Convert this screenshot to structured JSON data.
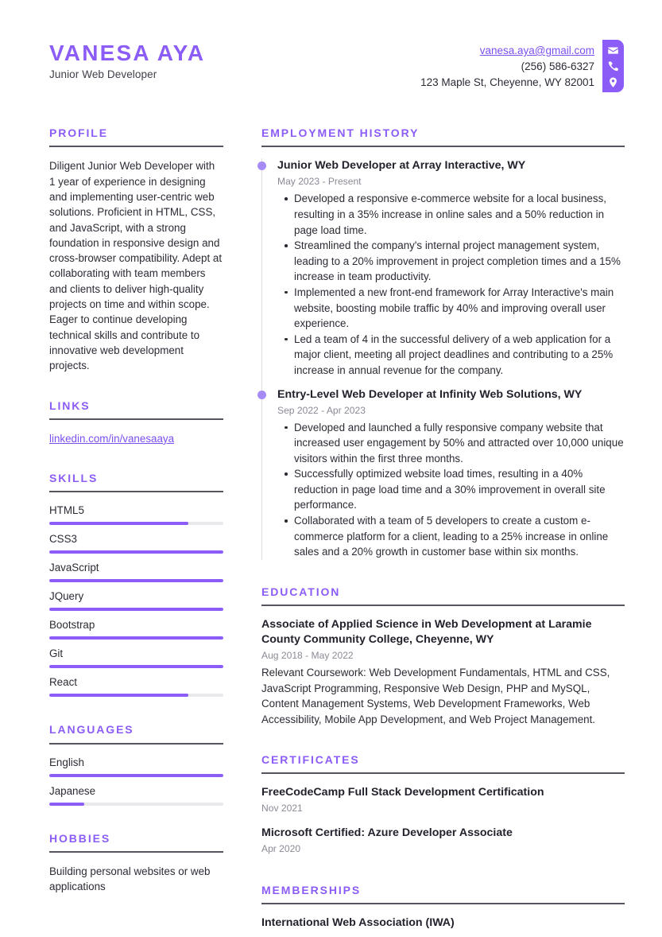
{
  "accent_color": "#8b5cf6",
  "link_color": "#7c4ff0",
  "rule_color": "#55555f",
  "header": {
    "name": "VANESA AYA",
    "title": "Junior Web Developer",
    "contacts": [
      {
        "icon": "envelope-icon",
        "value": "vanesa.aya@gmail.com",
        "is_link": true
      },
      {
        "icon": "phone-icon",
        "value": "(256) 586-6327",
        "is_link": false
      },
      {
        "icon": "location-pin-icon",
        "value": "123 Maple St, Cheyenne, WY 82001",
        "is_link": false
      }
    ]
  },
  "left": {
    "profile": {
      "heading": "PROFILE",
      "text": "Diligent Junior Web Developer with 1 year of experience in designing and implementing user-centric web solutions. Proficient in HTML, CSS, and JavaScript, with a strong foundation in responsive design and cross-browser compatibility. Adept at collaborating with team members and clients to deliver high-quality projects on time and within scope. Eager to continue developing technical skills and contribute to innovative web development projects."
    },
    "links": {
      "heading": "LINKS",
      "items": [
        {
          "label": "linkedin.com/in/vanesaaya"
        }
      ]
    },
    "skills": {
      "heading": "SKILLS",
      "items": [
        {
          "label": "HTML5",
          "level": 80
        },
        {
          "label": "CSS3",
          "level": 100
        },
        {
          "label": "JavaScript",
          "level": 100
        },
        {
          "label": "JQuery",
          "level": 100
        },
        {
          "label": "Bootstrap",
          "level": 100
        },
        {
          "label": "Git",
          "level": 100
        },
        {
          "label": "React",
          "level": 80
        }
      ]
    },
    "languages": {
      "heading": "LANGUAGES",
      "items": [
        {
          "label": "English",
          "level": 100
        },
        {
          "label": "Japanese",
          "level": 20
        }
      ]
    },
    "hobbies": {
      "heading": "HOBBIES",
      "text": "Building personal websites or web applications"
    }
  },
  "right": {
    "employment": {
      "heading": "EMPLOYMENT HISTORY",
      "jobs": [
        {
          "title": "Junior Web Developer at Array Interactive, WY",
          "date": "May 2023 - Present",
          "bullets": [
            "Developed a responsive e-commerce website for a local business, resulting in a 35% increase in online sales and a 50% reduction in page load time.",
            "Streamlined the company's internal project management system, leading to a 20% improvement in project completion times and a 15% increase in team productivity.",
            "Implemented a new front-end framework for Array Interactive's main website, boosting mobile traffic by 40% and improving overall user experience.",
            "Led a team of 4 in the successful delivery of a web application for a major client, meeting all project deadlines and contributing to a 25% increase in annual revenue for the company."
          ]
        },
        {
          "title": "Entry-Level Web Developer at Infinity Web Solutions, WY",
          "date": "Sep 2022 - Apr 2023",
          "bullets": [
            "Developed and launched a fully responsive company website that increased user engagement by 50% and attracted over 10,000 unique visitors within the first three months.",
            "Successfully optimized website load times, resulting in a 40% reduction in page load time and a 30% improvement in overall site performance.",
            "Collaborated with a team of 5 developers to create a custom e-commerce platform for a client, leading to a 25% increase in online sales and a 20% growth in customer base within six months."
          ]
        }
      ]
    },
    "education": {
      "heading": "EDUCATION",
      "entries": [
        {
          "title": "Associate of Applied Science in Web Development at Laramie County Community College, Cheyenne, WY",
          "date": "Aug 2018 - May 2022",
          "body": "Relevant Coursework: Web Development Fundamentals, HTML and CSS, JavaScript Programming, Responsive Web Design, PHP and MySQL, Content Management Systems, Web Development Frameworks, Web Accessibility, Mobile App Development, and Web Project Management."
        }
      ]
    },
    "certificates": {
      "heading": "CERTIFICATES",
      "entries": [
        {
          "title": "FreeCodeCamp Full Stack Development Certification",
          "date": "Nov 2021"
        },
        {
          "title": "Microsoft Certified: Azure Developer Associate",
          "date": "Apr 2020"
        }
      ]
    },
    "memberships": {
      "heading": "MEMBERSHIPS",
      "entries": [
        {
          "title": "International Web Association (IWA)"
        }
      ]
    }
  }
}
